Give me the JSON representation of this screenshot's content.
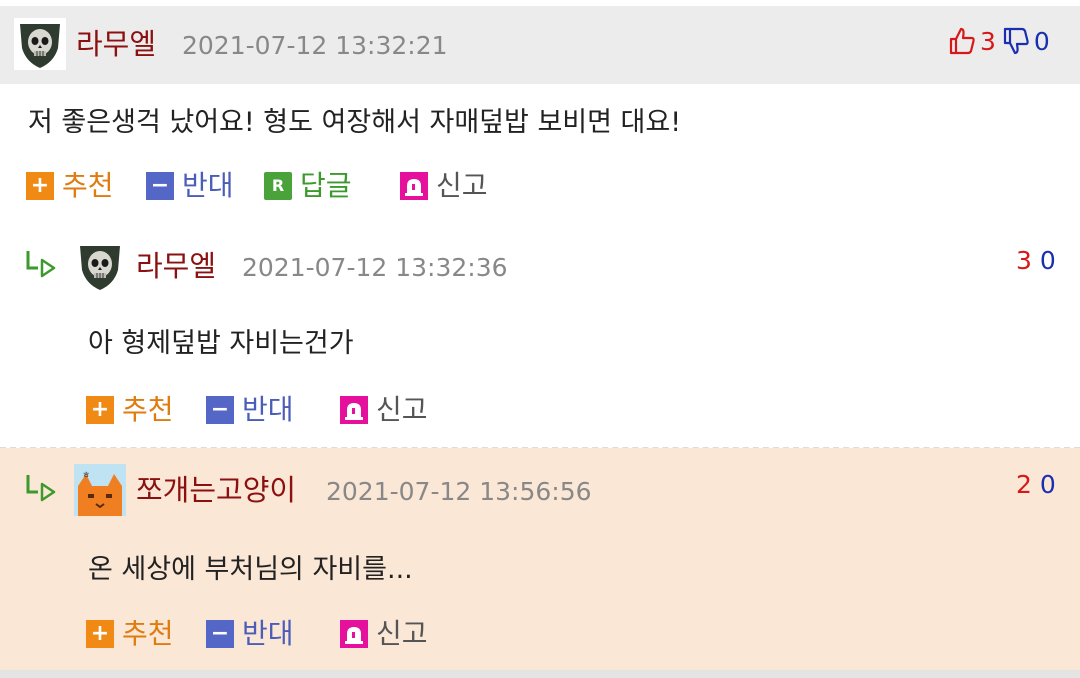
{
  "comments": [
    {
      "nick": "라무엘",
      "date": "2021-07-12 13:32:21",
      "text": "저 좋은생걱 났어요! 형도 여장해서 자매덮밥 보비면 대요!",
      "up": "3",
      "down": "0",
      "actions": {
        "recommend": "추천",
        "oppose": "반대",
        "reply": "답글",
        "report": "신고"
      },
      "reply_icon_letter": "R"
    },
    {
      "nick": "라무엘",
      "date": "2021-07-12 13:32:36",
      "text": "아 형제덮밥 자비는건가",
      "up": "3",
      "down": "0",
      "actions": {
        "recommend": "추천",
        "oppose": "반대",
        "report": "신고"
      }
    },
    {
      "nick": "쪼개는고양이",
      "date": "2021-07-12 13:56:56",
      "text": "온 세상에 부처님의 자비를...",
      "up": "2",
      "down": "0",
      "actions": {
        "recommend": "추천",
        "oppose": "반대",
        "report": "신고"
      }
    }
  ],
  "icons": {
    "plus": "+",
    "minus": "−"
  },
  "colors": {
    "nickname": "#8b1010",
    "recommend": "#f08a14",
    "oppose": "#5567c6",
    "reply": "#4aa33a",
    "report": "#e5109c",
    "upvote": "#d81818",
    "downvote": "#1a2fb0",
    "highlight_bg": "#fbe7d6"
  }
}
